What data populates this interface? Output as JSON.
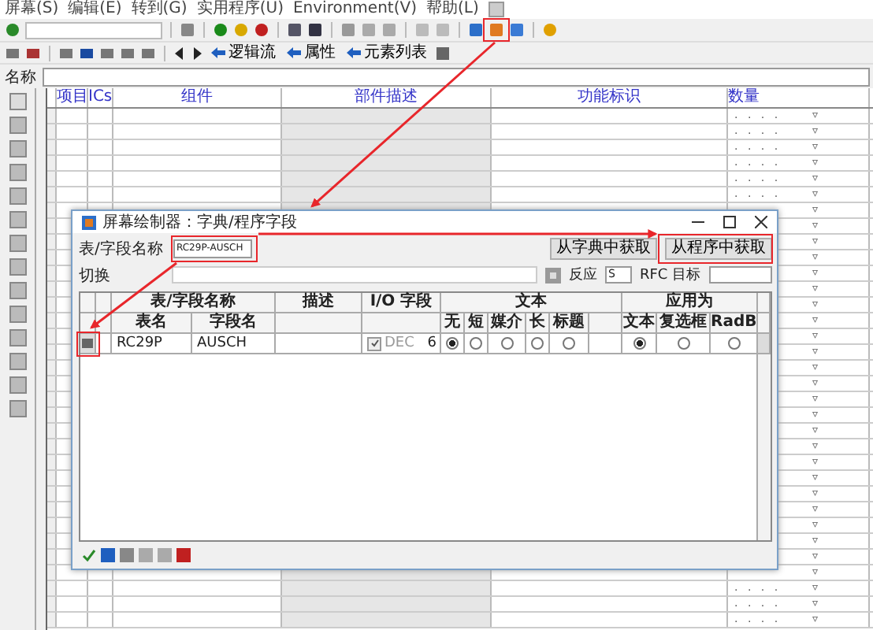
{
  "menu": [
    "屏幕(S)",
    "编辑(E)",
    "转到(G)",
    "实用程序(U)",
    "Environment(V)",
    "帮助(L)"
  ],
  "toolbar2": [
    {
      "label": "逻辑流"
    },
    {
      "label": "属性"
    },
    {
      "label": "元素列表"
    }
  ],
  "name_field": {
    "label": "名称"
  },
  "grid": {
    "columns": [
      "项目",
      "ICs",
      "组件",
      "部件描述",
      "功能标识",
      "数量"
    ],
    "rows": [
      {
        "dots": ". . . .",
        "mark": "▿"
      },
      {
        "dots": ". . . .",
        "mark": "▿"
      },
      {
        "dots": ". . . .",
        "mark": "▿"
      },
      {
        "dots": ". . . .",
        "mark": "▿"
      },
      {
        "dots": ". . . .",
        "mark": "▿"
      },
      {
        "dots": ". . . .",
        "mark": "▿"
      },
      {
        "mark": "▿"
      },
      {
        "mark": "▿"
      },
      {
        "mark": "▿"
      },
      {
        "mark": "▿"
      },
      {
        "mark": "▿"
      },
      {
        "mark": "▿"
      },
      {
        "mark": "▿"
      },
      {
        "mark": "▿"
      },
      {
        "mark": "▿"
      },
      {
        "mark": "▿"
      },
      {
        "mark": "▿"
      },
      {
        "mark": "▿"
      },
      {
        "mark": "▿"
      },
      {
        "mark": "▿"
      },
      {
        "mark": "▿"
      },
      {
        "mark": "▿"
      },
      {
        "mark": "▿"
      },
      {
        "mark": "▿"
      },
      {
        "mark": "▿"
      },
      {
        "mark": "▿"
      },
      {
        "mark": "▿"
      },
      {
        "mark": "▿"
      },
      {
        "mark": "▿"
      },
      {
        "mark": "▿"
      },
      {
        "dots": ". . . .",
        "mark": "▿"
      },
      {
        "dots": ". . . .",
        "mark": "▿"
      },
      {
        "dots": ". . . .",
        "mark": "▿"
      }
    ]
  },
  "dialog": {
    "title": "屏幕绘制器：字典/程序字段",
    "field_label": "表/字段名称",
    "field_value": "RC29P-AUSCH",
    "buttons": [
      "从字典中获取",
      "从程序中获取"
    ],
    "switch_label": "切换",
    "reaction_label": "反应",
    "reaction_value": "S",
    "rfc_label": "RFC 目标",
    "groups": [
      "表/字段名称",
      "描述",
      "I/O 字段",
      "文本",
      "应用为"
    ],
    "columns": [
      "表名",
      "字段名",
      "无",
      "短",
      "媒介",
      "长",
      "标题",
      "文本",
      "复选框",
      "RadB"
    ],
    "rows": [
      {
        "table": "RC29P",
        "field": "AUSCH",
        "io_checked": true,
        "io_type": "DEC",
        "io_length": "6",
        "text_options": [
          {
            "selected": true
          },
          {
            "selected": false
          },
          {
            "selected": false
          },
          {
            "selected": false
          },
          {
            "selected": false
          }
        ],
        "apply_options": [
          {
            "selected": true
          },
          {
            "selected": false
          },
          {
            "selected": false
          }
        ]
      }
    ]
  }
}
